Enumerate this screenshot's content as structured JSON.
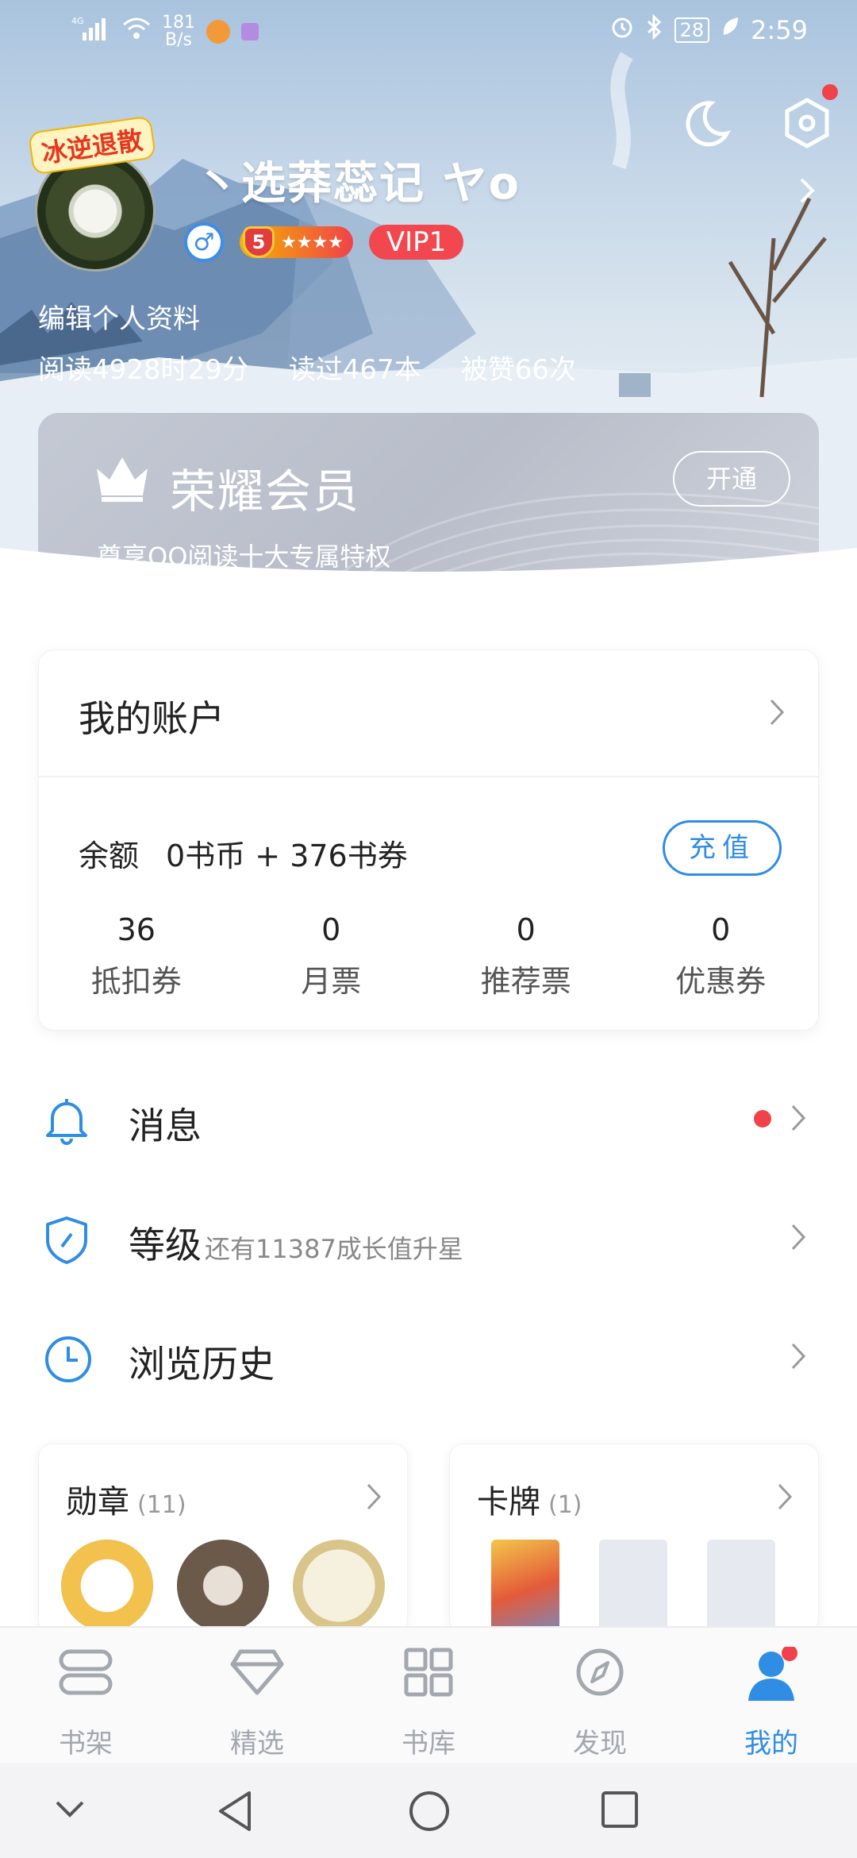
{
  "status_bar": {
    "network": "4G",
    "speed": "181",
    "speed_unit": "B/s",
    "battery": "28",
    "time": "2:59"
  },
  "profile": {
    "pendant_text": "冰逆退散",
    "nickname": "丶选莽蕊记 ヤo",
    "gender_symbol": "♂",
    "level": "5",
    "level_stars": "★★★★",
    "vip": "VIP1",
    "edit_label": "编辑个人资料",
    "stats": [
      "阅读4928时29分",
      "读过467本",
      "被赞66次"
    ]
  },
  "member": {
    "title": "荣耀会员",
    "subtitle": "尊享QQ阅读十大专属特权",
    "open_label": "开通"
  },
  "account": {
    "title": "我的账户",
    "balance_label": "余额",
    "balance_value": "0书币 + 376书券",
    "recharge_label": "充值",
    "items": [
      {
        "num": "36",
        "label": "抵扣券"
      },
      {
        "num": "0",
        "label": "月票"
      },
      {
        "num": "0",
        "label": "推荐票"
      },
      {
        "num": "0",
        "label": "优惠券"
      }
    ]
  },
  "menu": {
    "messages": "消息",
    "level": "等级",
    "level_hint": "还有11387成长值升星",
    "history": "浏览历史"
  },
  "medals": {
    "title": "勋章",
    "count": "(11)"
  },
  "cards": {
    "title": "卡牌",
    "count": "(1)"
  },
  "tabs": [
    {
      "label": "书架",
      "icon": "bookshelf-icon"
    },
    {
      "label": "精选",
      "icon": "diamond-icon"
    },
    {
      "label": "书库",
      "icon": "grid-icon"
    },
    {
      "label": "发现",
      "icon": "compass-icon"
    },
    {
      "label": "我的",
      "icon": "person-icon"
    }
  ],
  "colors": {
    "accent": "#2f8de4",
    "vip": "#f2474f",
    "notify": "#f0424a"
  }
}
